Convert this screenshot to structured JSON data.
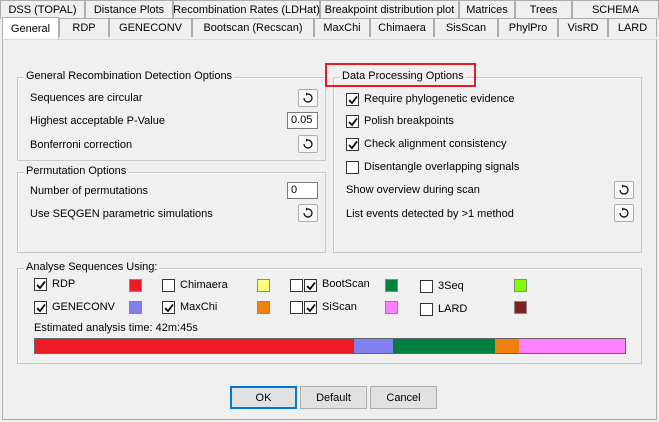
{
  "tabs_row1": [
    {
      "label": "DSS (TOPAL)"
    },
    {
      "label": "Distance Plots"
    },
    {
      "label": "Recombination Rates (LDHat)"
    },
    {
      "label": "Breakpoint distribution plot"
    },
    {
      "label": "Matrices"
    },
    {
      "label": "Trees"
    },
    {
      "label": "SCHEMA"
    }
  ],
  "tabs_row2": [
    {
      "label": "General"
    },
    {
      "label": "RDP"
    },
    {
      "label": "GENECONV"
    },
    {
      "label": "Bootscan (Recscan)"
    },
    {
      "label": "MaxChi"
    },
    {
      "label": "Chimaera"
    },
    {
      "label": "SisScan"
    },
    {
      "label": "PhylPro"
    },
    {
      "label": "VisRD"
    },
    {
      "label": "LARD"
    }
  ],
  "general_recombination": {
    "title": "General Recombination Detection Options",
    "circular_label": "Sequences are circular",
    "pvalue_label": "Highest acceptable P-Value",
    "pvalue_value": "0.05",
    "bonferroni_label": "Bonferroni correction"
  },
  "permutation": {
    "title": "Permutation Options",
    "num_label": "Number of permutations",
    "num_value": "0",
    "seqgen_label": "Use SEQGEN parametric simulations"
  },
  "data_processing": {
    "title": "Data Processing Options",
    "phylo_label": "Require phylogenetic evidence",
    "phylo_checked": true,
    "polish_label": "Polish breakpoints",
    "polish_checked": true,
    "alignment_label": "Check alignment consistency",
    "alignment_checked": true,
    "disentangle_label": "Disentangle overlapping signals",
    "disentangle_checked": false,
    "overview_label": "Show overview during scan",
    "list_events_label": "List events detected by >1 method"
  },
  "analyse": {
    "title": "Analyse Sequences Using:",
    "methods": [
      {
        "label": "RDP",
        "checked": true,
        "color": "#ed1c24"
      },
      {
        "label": "GENECONV",
        "checked": true,
        "color": "#8080f0"
      },
      {
        "label": "Chimaera",
        "checked": false,
        "color": "#ffff80"
      },
      {
        "label": "MaxChi",
        "checked": true,
        "color": "#f08010"
      },
      {
        "label": "BootScan",
        "checked": true,
        "color": "#008040"
      },
      {
        "label": "SiScan",
        "checked": true,
        "color": "#ff80ff"
      },
      {
        "label": "3Seq",
        "checked": false,
        "color": "#80ff00"
      },
      {
        "label": "LARD",
        "checked": false,
        "color": "#802020"
      }
    ],
    "estimate_label": "Estimated analysis time: 42m:45s",
    "bar_segments": [
      {
        "color": "#ed1c24",
        "fraction": 0.541
      },
      {
        "color": "#8080f0",
        "fraction": 0.066
      },
      {
        "color": "#008040",
        "fraction": 0.172
      },
      {
        "color": "#f08010",
        "fraction": 0.042
      },
      {
        "color": "#ff80ff",
        "fraction": 0.179
      }
    ]
  },
  "buttons": {
    "ok": "OK",
    "default": "Default",
    "cancel": "Cancel"
  }
}
